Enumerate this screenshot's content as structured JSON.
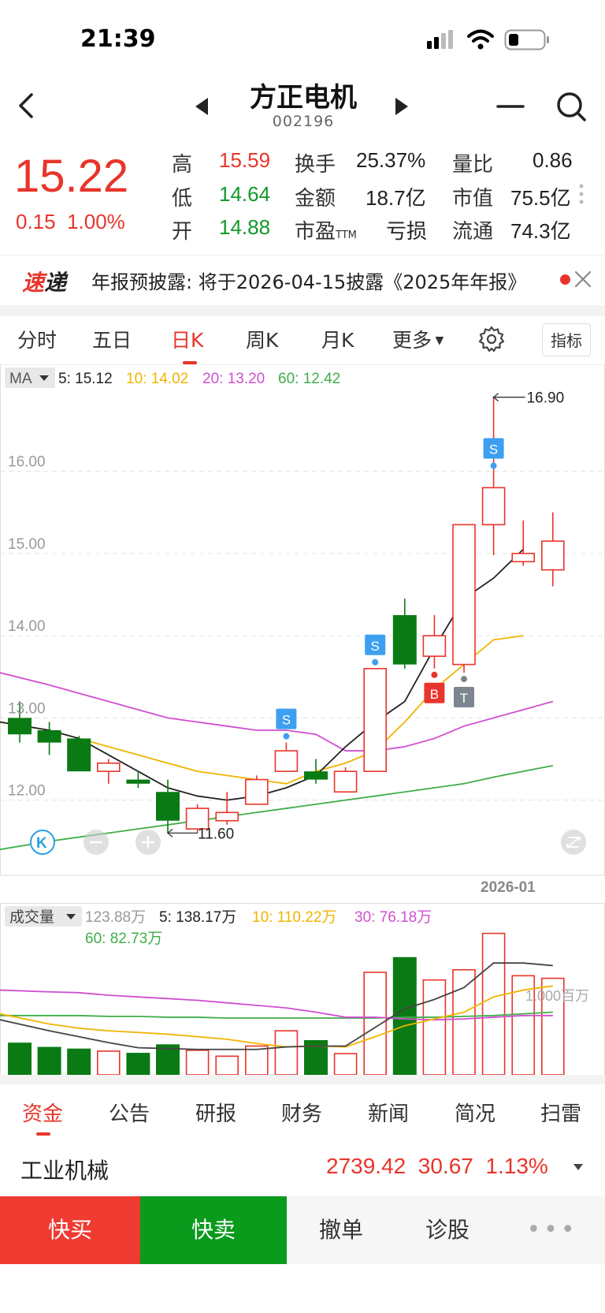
{
  "status_bar": {
    "time": "21:39"
  },
  "header": {
    "name": "方正电机",
    "code": "002196"
  },
  "quote": {
    "price": "15.22",
    "change": "0.15",
    "change_pct": "1.00%",
    "stats": [
      {
        "label": "高",
        "value": "15.59",
        "color": "red"
      },
      {
        "label": "低",
        "value": "14.64",
        "color": "green"
      },
      {
        "label": "开",
        "value": "14.88",
        "color": "green"
      },
      {
        "label": "换手",
        "value": "25.37%"
      },
      {
        "label": "金额",
        "value": "18.7亿"
      },
      {
        "label": "市盈",
        "sub": "TTM",
        "value": "亏损"
      },
      {
        "label": "量比",
        "value": "0.86"
      },
      {
        "label": "市值",
        "value": "75.5亿"
      },
      {
        "label": "流通",
        "value": "74.3亿"
      }
    ]
  },
  "news": {
    "logo_a": "速",
    "logo_b": "递",
    "text": "年报预披露: 将于2026-04-15披露《2025年年报》"
  },
  "chart_tabs": [
    "分时",
    "五日",
    "日K",
    "周K",
    "月K",
    "更多"
  ],
  "indicator_button": "指标",
  "ma_legend": {
    "selector": "MA",
    "items": [
      {
        "label": "5: 15.12",
        "color": "#222222"
      },
      {
        "label": "10: 14.02",
        "color": "#f0b400"
      },
      {
        "label": "20: 13.20",
        "color": "#d04fd0"
      },
      {
        "label": "60: 12.42",
        "color": "#3fae4a"
      }
    ]
  },
  "price_axis": [
    "16.00",
    "15.00",
    "14.00",
    "13.00",
    "12.00"
  ],
  "annotations": {
    "high": "16.90",
    "low": "11.60",
    "date": "2026-01"
  },
  "signals": [
    "S",
    "S",
    "S",
    "B",
    "T"
  ],
  "volume_legend": {
    "selector": "成交量",
    "current": "123.88万",
    "items": [
      {
        "label": "5: 138.17万",
        "color": "#222222"
      },
      {
        "label": "10: 110.22万",
        "color": "#f0b400"
      },
      {
        "label": "30: 76.18万",
        "color": "#d04fd0"
      },
      {
        "label": "60: 82.73万",
        "color": "#3fae4a"
      }
    ],
    "axis_label": "1.000百万"
  },
  "colors": {
    "up": "#e8352b",
    "down": "#0a7a14"
  },
  "chart_data": {
    "type": "candlestick",
    "ylim": [
      11.45,
      17.3
    ],
    "candles": [
      {
        "o": 13.0,
        "h": 13.2,
        "l": 12.7,
        "c": 12.8
      },
      {
        "o": 12.85,
        "h": 12.95,
        "l": 12.55,
        "c": 12.7
      },
      {
        "o": 12.75,
        "h": 12.78,
        "l": 12.35,
        "c": 12.35
      },
      {
        "o": 12.35,
        "h": 12.5,
        "l": 12.2,
        "c": 12.45
      },
      {
        "o": 12.25,
        "h": 12.35,
        "l": 12.15,
        "c": 12.2
      },
      {
        "o": 12.1,
        "h": 12.25,
        "l": 11.6,
        "c": 11.75
      },
      {
        "o": 11.65,
        "h": 11.95,
        "l": 11.6,
        "c": 11.9
      },
      {
        "o": 11.75,
        "h": 12.1,
        "l": 11.7,
        "c": 11.85
      },
      {
        "o": 11.95,
        "h": 12.3,
        "l": 11.95,
        "c": 12.25
      },
      {
        "o": 12.35,
        "h": 12.7,
        "l": 12.35,
        "c": 12.6
      },
      {
        "o": 12.35,
        "h": 12.5,
        "l": 12.2,
        "c": 12.25
      },
      {
        "o": 12.1,
        "h": 12.4,
        "l": 12.1,
        "c": 12.35
      },
      {
        "o": 12.35,
        "h": 13.6,
        "l": 12.35,
        "c": 13.6
      },
      {
        "o": 14.25,
        "h": 14.45,
        "l": 13.6,
        "c": 13.65
      },
      {
        "o": 13.75,
        "h": 14.25,
        "l": 13.6,
        "c": 14.0
      },
      {
        "o": 13.65,
        "h": 15.35,
        "l": 13.55,
        "c": 15.35
      },
      {
        "o": 15.35,
        "h": 16.9,
        "l": 14.98,
        "c": 15.8
      },
      {
        "o": 14.9,
        "h": 15.4,
        "l": 14.85,
        "c": 15.0
      },
      {
        "o": 14.8,
        "h": 15.5,
        "l": 14.6,
        "c": 15.15
      }
    ],
    "ma5": [
      12.95,
      12.85,
      12.75,
      12.55,
      12.35,
      12.15,
      12.05,
      12.0,
      12.05,
      12.15,
      12.3,
      12.65,
      12.95,
      13.2,
      13.85,
      14.45,
      14.7,
      15.05
    ],
    "ma10": [
      12.95,
      12.85,
      12.75,
      12.65,
      12.55,
      12.45,
      12.35,
      12.3,
      12.25,
      12.2,
      12.35,
      12.45,
      12.6,
      12.95,
      13.35,
      13.65,
      13.95,
      14.0
    ],
    "ma20": [
      13.55,
      13.4,
      13.3,
      13.2,
      13.1,
      13.0,
      12.95,
      12.9,
      12.85,
      12.85,
      12.8,
      12.6,
      12.6,
      12.65,
      12.75,
      12.9,
      13.0,
      13.1,
      13.2
    ],
    "ma60": [
      11.4,
      11.5,
      11.55,
      11.6,
      11.65,
      11.7,
      11.75,
      11.8,
      11.85,
      11.9,
      11.95,
      12.0,
      12.05,
      12.1,
      12.15,
      12.2,
      12.28,
      12.35,
      12.42
    ],
    "volume": [
      0.38,
      0.33,
      0.31,
      0.28,
      0.26,
      0.36,
      0.29,
      0.22,
      0.34,
      0.52,
      0.41,
      0.25,
      1.21,
      1.39,
      1.12,
      1.24,
      1.67,
      1.17,
      1.14
    ],
    "vol_ma5": [
      0.65,
      0.52,
      0.45,
      0.38,
      0.32,
      0.31,
      0.3,
      0.3,
      0.3,
      0.33,
      0.34,
      0.34,
      0.56,
      0.78,
      0.89,
      1.03,
      1.32,
      1.32,
      1.29
    ],
    "vol_ma10": [
      0.72,
      0.6,
      0.55,
      0.52,
      0.5,
      0.48,
      0.45,
      0.42,
      0.37,
      0.33,
      0.34,
      0.33,
      0.45,
      0.58,
      0.66,
      0.74,
      0.92,
      1.0,
      1.05
    ],
    "vol_ma30": [
      1.0,
      0.98,
      0.97,
      0.94,
      0.92,
      0.9,
      0.88,
      0.85,
      0.82,
      0.79,
      0.74,
      0.68,
      0.68,
      0.66,
      0.65,
      0.66,
      0.68,
      0.7,
      0.7
    ],
    "vol_ma60": [
      0.7,
      0.7,
      0.7,
      0.69,
      0.69,
      0.68,
      0.68,
      0.67,
      0.67,
      0.67,
      0.67,
      0.67,
      0.67,
      0.68,
      0.68,
      0.69,
      0.7,
      0.72,
      0.74
    ],
    "vol_ylim": [
      0,
      1.75
    ]
  },
  "bottom_tabs": [
    "资金",
    "公告",
    "研报",
    "财务",
    "新闻",
    "简况",
    "扫雷"
  ],
  "sector": {
    "name": "工业机械",
    "quote": "2739.42  30.67  1.13%"
  },
  "actions": {
    "quick_buy": "快买",
    "quick_sell": "快卖",
    "cancel": "撤单",
    "diagnose": "诊股",
    "more": "•••"
  }
}
